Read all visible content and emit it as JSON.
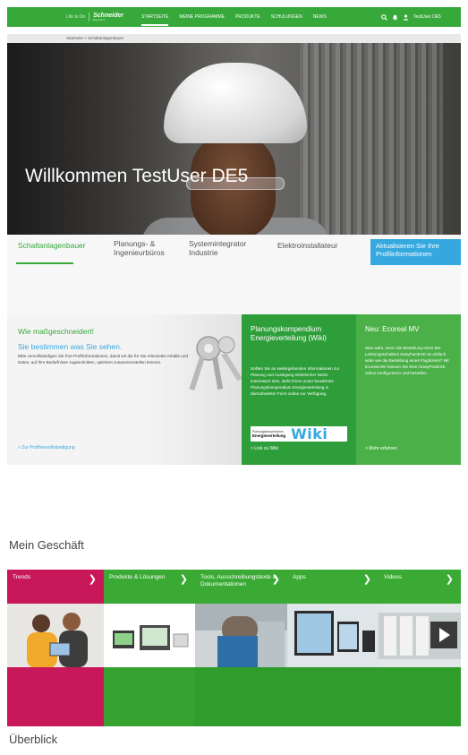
{
  "topnav": {
    "tagline": "Life is On",
    "logo": "Schneider",
    "logo_sub": "Electric",
    "links": [
      {
        "label": "STARTSEITE",
        "active": true
      },
      {
        "label": "MEINE PROGRAMME",
        "active": false
      },
      {
        "label": "PRODUKTE",
        "active": false
      },
      {
        "label": "SCHULUNGEN",
        "active": false
      },
      {
        "label": "NEWS",
        "active": false
      }
    ],
    "user_label": "TestUser DE5",
    "icons": [
      "search-icon",
      "bell-icon",
      "user-icon"
    ]
  },
  "breadcrumb": {
    "text": "Startseite > Schaltanlagenbauer"
  },
  "hero": {
    "welcome": "Willkommen TestUser DE5"
  },
  "tabs": {
    "items": [
      {
        "label": "Schaltanlagenbauer",
        "active": true
      },
      {
        "label": "Planungs- & Ingenieurbüros",
        "active": false
      },
      {
        "label": "Systemintegrator Industrie",
        "active": false
      },
      {
        "label": "Elektroinstallateur",
        "active": false
      }
    ],
    "update_button": "Aktualisieren Sie Ihre Profilinformationen"
  },
  "promo": {
    "heading": "Wie maßgeschneidert!",
    "subheading": "Sie bestimmen was Sie sehen.",
    "body": "Bitte vervollständigen Sie Ihre Profilinformationen, damit wir die für Sie relevanten Inhalte und Daten, auf Ihre Bedürfnisse zugeschnitten, optimiert zusammenstellen können.",
    "link": "> Zur Profilvervollständigung"
  },
  "wiki": {
    "title": "Planungskompendium Energieverteilung (Wiki)",
    "body": "Sollten Sie an weitergehenden Informationen zur Planung und Auslegung elektrischer Netze interessiert sein, steht Ihnen unser bewährtes Planungskompendium Energieverteilung in überarbeiteter Form online zur Verfügung.",
    "logo_small": "Planungskompendium",
    "logo_bold": "Energieverteilung",
    "logo_word": "Wiki",
    "link": "> Link zu Wiki"
  },
  "ecoreal": {
    "title": "Neu: Ecoreal MV",
    "body": "Was wäre, wenn die Bestellung eines MS-Leistungsschalters EasyPactEXE so einfach wäre wie die Bestellung eines Flugtickets? Mit Ecoreal MV können Sie Ihren EasyPactEXE online konfigurieren und bestellen.",
    "link": "> Mehr erfahren"
  },
  "mein_geschaeft": {
    "title": "Mein Geschäft",
    "categories": [
      {
        "label": "Trends",
        "color": "#c8185a"
      },
      {
        "label": "Produkte & Lösungen",
        "color": "#3aaa35"
      },
      {
        "label": "Tools, Ausschreibungstexte & Dokumentationen",
        "color": "#3aaa35"
      },
      {
        "label": "Apps",
        "color": "#3aaa35"
      },
      {
        "label": "Videos",
        "color": "#3aaa35"
      }
    ]
  },
  "ueberblick": {
    "title": "Überblick"
  },
  "colors": {
    "brand_green": "#37a83a",
    "accent_blue": "#36a8e0",
    "trends_magenta": "#c8185a"
  }
}
